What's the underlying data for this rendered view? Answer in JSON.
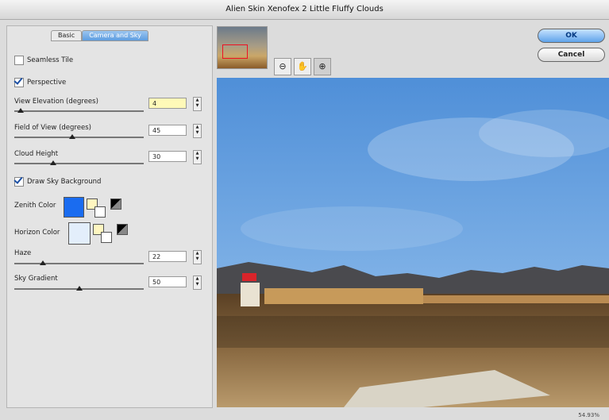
{
  "window": {
    "title": "Alien Skin Xenofex 2 Little Fluffy Clouds"
  },
  "tabs": [
    {
      "label": "Basic"
    },
    {
      "label": "Camera and Sky"
    }
  ],
  "options": {
    "seamless_tile": {
      "label": "Seamless Tile",
      "checked": false
    },
    "perspective": {
      "label": "Perspective",
      "checked": true
    },
    "draw_sky": {
      "label": "Draw Sky Background",
      "checked": true
    }
  },
  "sliders": {
    "view_elevation": {
      "label": "View Elevation (degrees)",
      "value": "4",
      "fraction": 0.05
    },
    "field_of_view": {
      "label": "Field of View (degrees)",
      "value": "45",
      "fraction": 0.45
    },
    "cloud_height": {
      "label": "Cloud Height",
      "value": "30",
      "fraction": 0.3
    },
    "haze": {
      "label": "Haze",
      "value": "22",
      "fraction": 0.22
    },
    "sky_gradient": {
      "label": "Sky Gradient",
      "value": "50",
      "fraction": 0.5
    }
  },
  "colors": {
    "zenith": {
      "label": "Zenith Color",
      "value": "#1a6cf0"
    },
    "horizon": {
      "label": "Horizon Color",
      "value": "#e3eefb"
    }
  },
  "buttons": {
    "ok": "OK",
    "cancel": "Cancel"
  },
  "tools": [
    {
      "icon": "zoom-out-icon"
    },
    {
      "icon": "hand-icon"
    },
    {
      "icon": "zoom-in-icon"
    }
  ],
  "status": {
    "zoom": "54.93%"
  }
}
